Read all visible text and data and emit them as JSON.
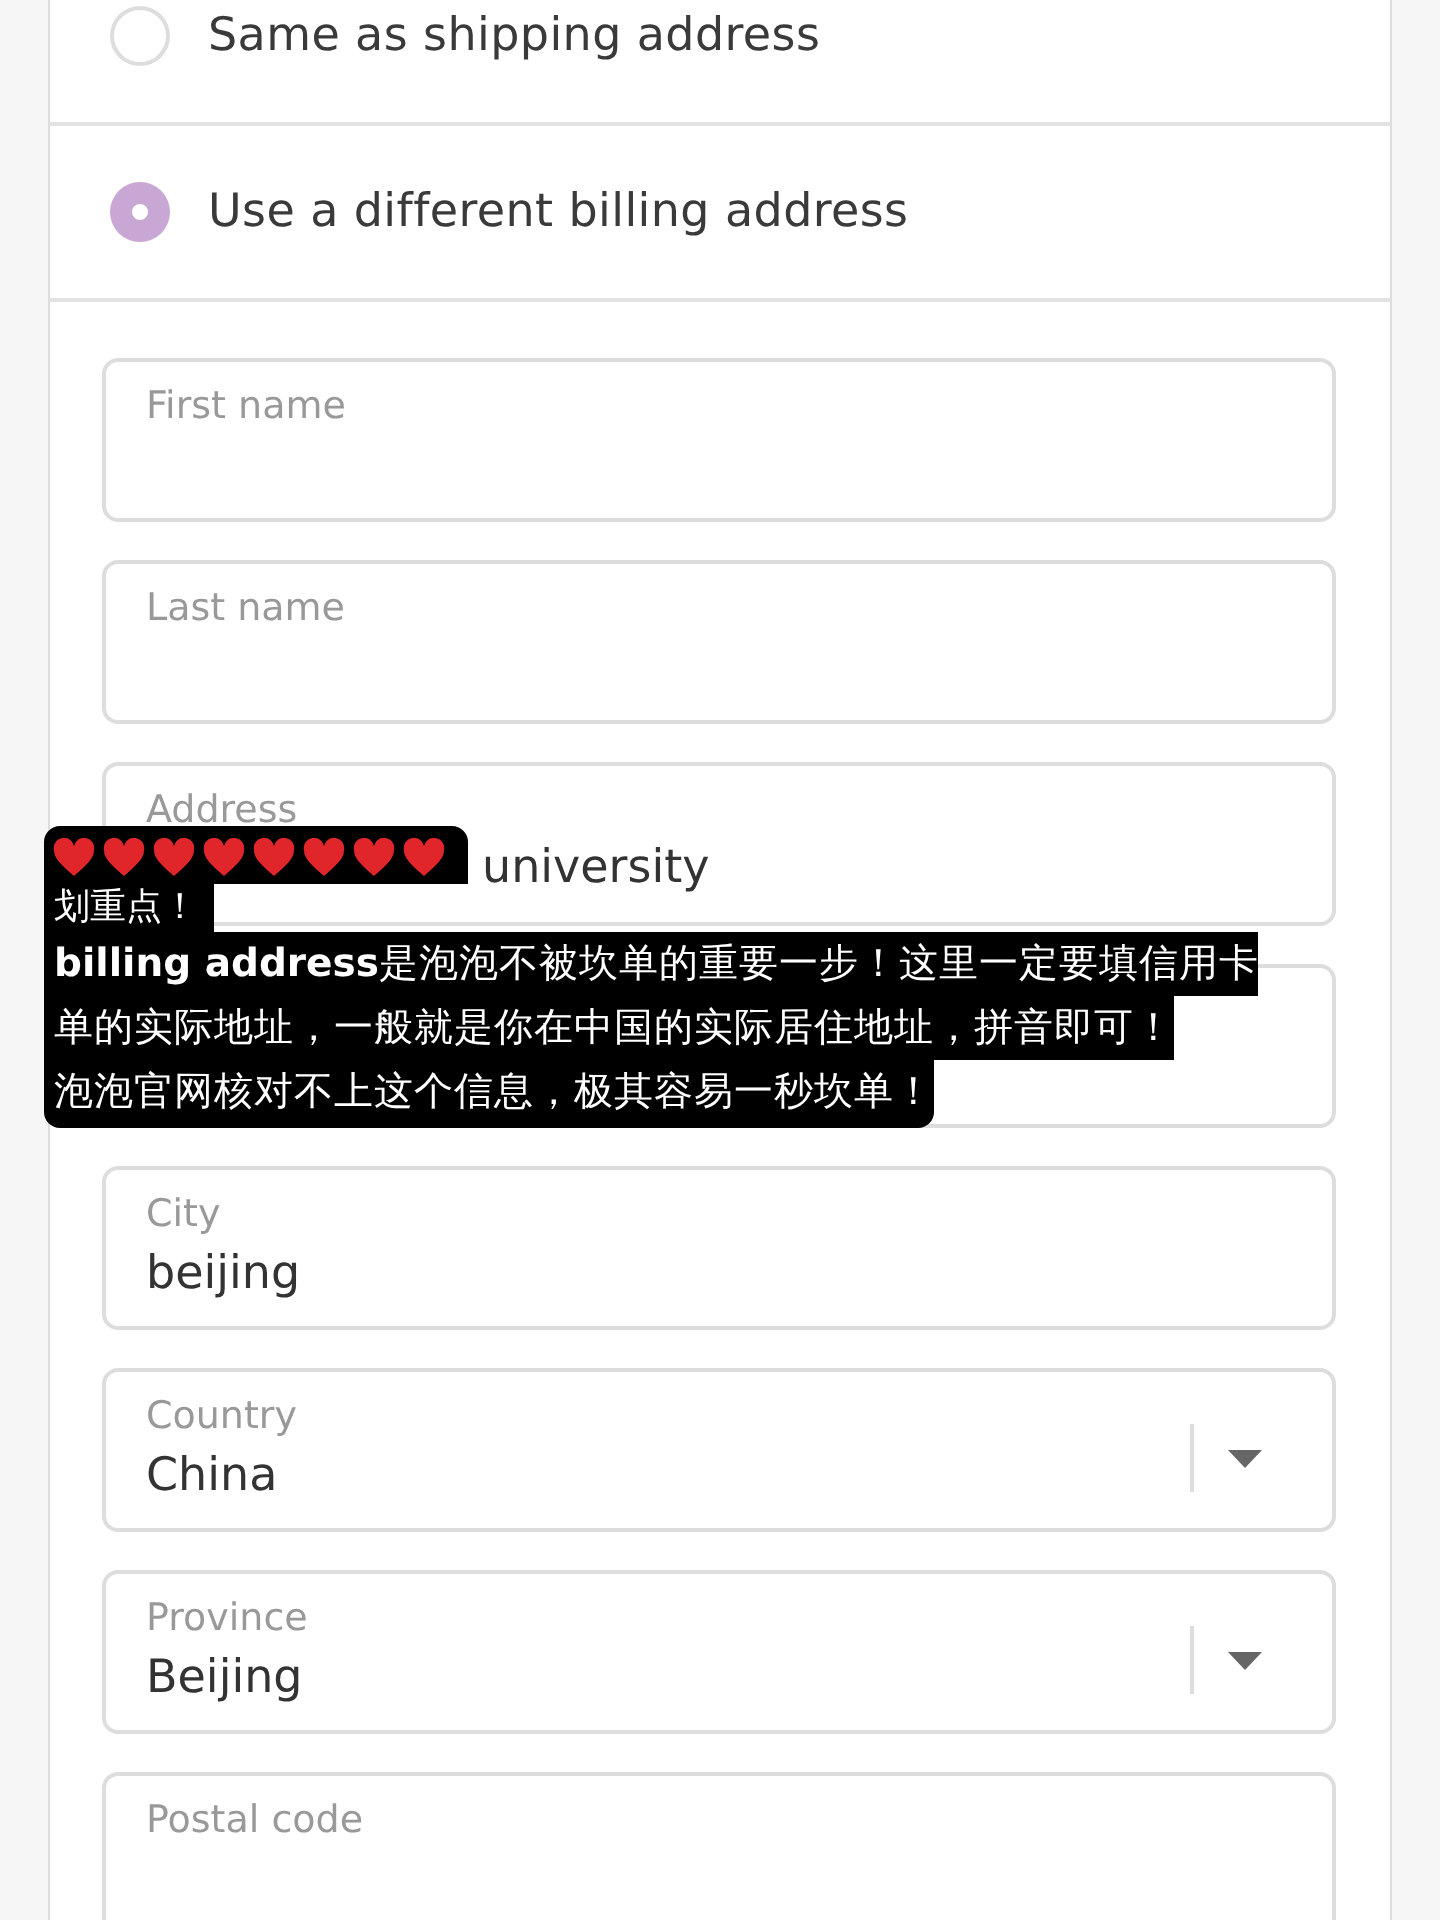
{
  "billing_options": [
    {
      "label": "Same as shipping address",
      "selected": false
    },
    {
      "label": "Use a different billing address",
      "selected": true
    }
  ],
  "fields": [
    {
      "kind": "text",
      "label": "First name"
    },
    {
      "kind": "text",
      "label": "Last name"
    },
    {
      "kind": "text",
      "label": "Address",
      "value": "university"
    },
    {
      "kind": "text"
    },
    {
      "kind": "text",
      "label": "City",
      "value": "beijing"
    },
    {
      "kind": "select",
      "label": "Country",
      "value": "China"
    },
    {
      "kind": "select",
      "label": "Province",
      "value": "Beijing"
    },
    {
      "kind": "text",
      "label": "Postal code"
    }
  ],
  "caption": {
    "title": "划重点！",
    "lines": [
      "**billing address**是泡泡不被坎单的重要一步！这里一定要填信用卡",
      "单的实际地址，一般就是你在中国的实际居住地址，拼音即可！",
      "泡泡官网核对不上这个信息，极其容易一秒坎单！"
    ]
  }
}
